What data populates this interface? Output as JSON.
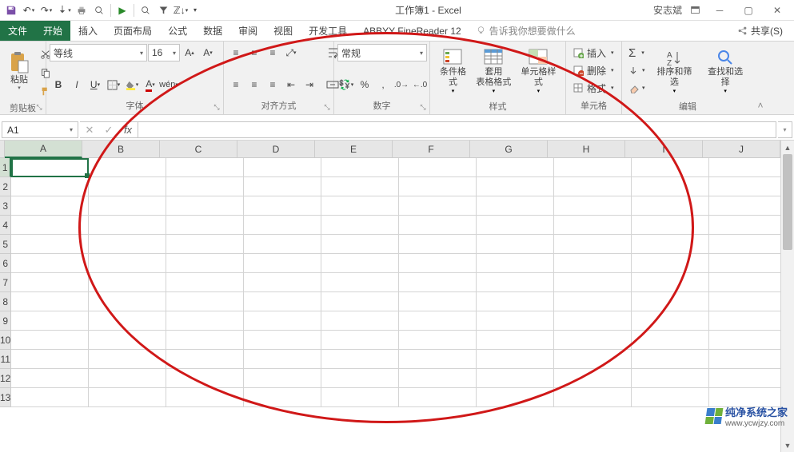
{
  "titlebar": {
    "title": "工作簿1 - Excel",
    "user": "安志斌"
  },
  "tabs": {
    "file": "文件",
    "items": [
      "开始",
      "插入",
      "页面布局",
      "公式",
      "数据",
      "审阅",
      "视图",
      "开发工具",
      "ABBYY FineReader 12"
    ],
    "active_index": 0,
    "tellme": "告诉我你想要做什么",
    "share": "共享(S)"
  },
  "ribbon": {
    "clipboard": {
      "paste": "粘贴",
      "label": "剪贴板"
    },
    "font": {
      "name": "等线",
      "size": "16",
      "label": "字体"
    },
    "alignment": {
      "label": "对齐方式"
    },
    "number": {
      "format": "常规",
      "label": "数字"
    },
    "styles": {
      "cond": "条件格式",
      "table": "套用\n表格格式",
      "cell": "单元格样式",
      "label": "样式"
    },
    "cells": {
      "insert": "插入",
      "delete": "删除",
      "format": "格式",
      "label": "单元格"
    },
    "editing": {
      "sort": "排序和筛选",
      "find": "查找和选择",
      "label": "编辑"
    }
  },
  "formula_bar": {
    "name_box": "A1"
  },
  "grid": {
    "columns": [
      "A",
      "B",
      "C",
      "D",
      "E",
      "F",
      "G",
      "H",
      "I",
      "J"
    ],
    "rows": [
      1,
      2,
      3,
      4,
      5,
      6,
      7,
      8,
      9,
      10,
      11,
      12,
      13
    ]
  },
  "watermark": {
    "brand": "纯净系统之家",
    "url": "www.ycwjzy.com"
  }
}
